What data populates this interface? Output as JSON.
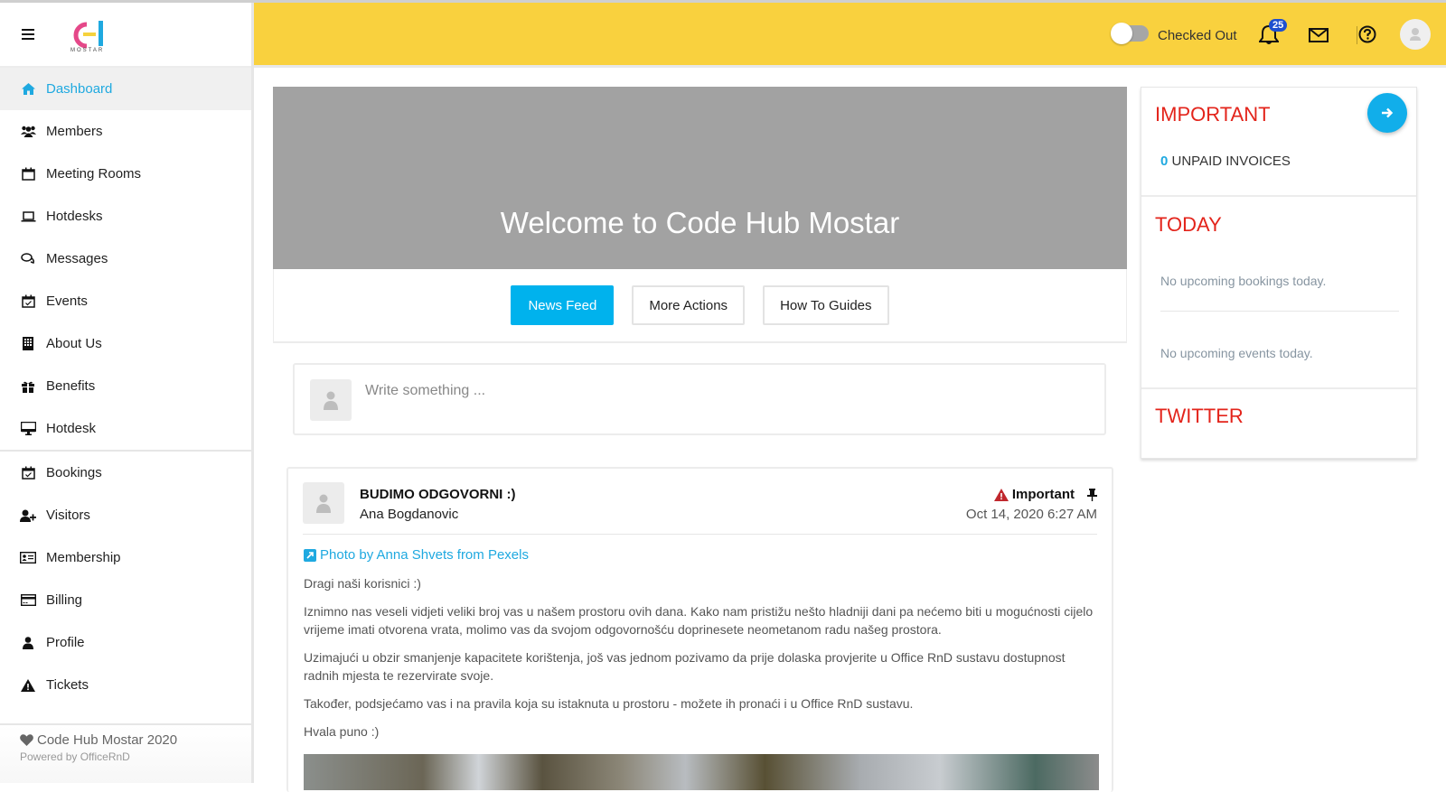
{
  "brand": {
    "logo_caption": "MOSTAR"
  },
  "sidebar": {
    "items": [
      {
        "label": "Dashboard",
        "icon": "home-icon",
        "active": true
      },
      {
        "label": "Members",
        "icon": "users-icon"
      },
      {
        "label": "Meeting Rooms",
        "icon": "calendar-icon"
      },
      {
        "label": "Hotdesks",
        "icon": "laptop-icon"
      },
      {
        "label": "Messages",
        "icon": "comments-icon"
      },
      {
        "label": "Events",
        "icon": "calendar-check-icon"
      },
      {
        "label": "About Us",
        "icon": "building-icon"
      },
      {
        "label": "Benefits",
        "icon": "gift-icon"
      },
      {
        "label": "Hotdesk",
        "icon": "desktop-icon"
      },
      {
        "label": "Bookings",
        "icon": "calendar-check-icon"
      },
      {
        "label": "Visitors",
        "icon": "user-plus-icon"
      },
      {
        "label": "Membership",
        "icon": "id-card-icon"
      },
      {
        "label": "Billing",
        "icon": "credit-card-icon"
      },
      {
        "label": "Profile",
        "icon": "user-icon"
      },
      {
        "label": "Tickets",
        "icon": "warning-icon"
      }
    ],
    "footer": {
      "title": "Code Hub Mostar 2020",
      "powered": "Powered by OfficeRnD"
    }
  },
  "header": {
    "status_label": "Checked Out",
    "checked_in": false,
    "notification_count": "25"
  },
  "main": {
    "hero_title": "Welcome to Code Hub Mostar",
    "tabs": [
      {
        "label": "News Feed",
        "active": true
      },
      {
        "label": "More Actions"
      },
      {
        "label": "How To Guides"
      }
    ],
    "composer": {
      "placeholder": "Write something ..."
    },
    "post": {
      "title": "BUDIMO ODGOVORNI :)",
      "author": "Ana Bogdanovic",
      "tag": "Important",
      "date": "Oct 14, 2020 6:27 AM",
      "link": "Photo by Anna Shvets from Pexels",
      "paragraphs": [
        "Dragi naši korisnici :)",
        "Iznimno nas veseli vidjeti veliki broj vas u našem prostoru ovih dana. Kako nam pristižu nešto hladniji dani pa nećemo biti u mogućnosti cijelo vrijeme imati otvorena vrata, molimo vas da svojom odgovornošću doprinesete neometanom radu našeg prostora.",
        "Uzimajući u obzir smanjenje kapacitete korištenja, još vas jednom pozivamo da prije dolaska provjerite u Office RnD sustavu dostupnost radnih mjesta te rezervirate svoje.",
        "Također, podsjećamo vas i na pravila koja su istaknuta u prostoru - možete ih pronaći i u Office RnD sustavu.",
        "Hvala puno :)"
      ]
    }
  },
  "right": {
    "important_title": "IMPORTANT",
    "unpaid_count": "0",
    "unpaid_label": "UNPAID INVOICES",
    "today_title": "TODAY",
    "no_bookings": "No upcoming bookings today.",
    "no_events": "No upcoming events today.",
    "twitter_title": "TWITTER"
  },
  "colors": {
    "accent": "#00b2ed",
    "header": "#f9d13e",
    "danger": "#e3241b"
  }
}
